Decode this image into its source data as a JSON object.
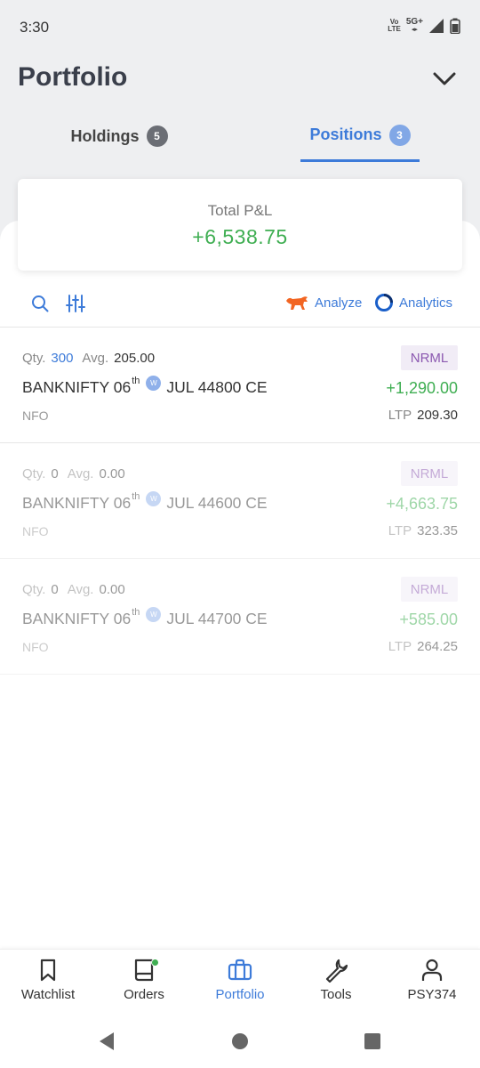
{
  "status_bar": {
    "time": "3:30",
    "volte_line1": "Vo",
    "volte_line2": "LTE",
    "network_label": "5G+"
  },
  "header": {
    "title": "Portfolio",
    "collapse_icon": "chevron-down-icon"
  },
  "tabs": [
    {
      "label": "Holdings",
      "count": "5",
      "active": false
    },
    {
      "label": "Positions",
      "count": "3",
      "active": true
    }
  ],
  "summary": {
    "label": "Total P&L",
    "value": "+6,538.75"
  },
  "toolbar": {
    "search_icon": "search-icon",
    "filter_icon": "sliders-icon",
    "analyze_label": "Analyze",
    "analytics_label": "Analytics"
  },
  "positions": [
    {
      "qty_label": "Qty.",
      "qty": "300",
      "avg_label": "Avg.",
      "avg": "205.00",
      "product": "NRML",
      "symbol": "BANKNIFTY 06",
      "suffix": "th",
      "weekly": "W",
      "contract": "JUL 44800 CE",
      "pnl": "+1,290.00",
      "exchange": "NFO",
      "ltp_label": "LTP",
      "ltp": "209.30",
      "closed": false
    },
    {
      "qty_label": "Qty.",
      "qty": "0",
      "avg_label": "Avg.",
      "avg": "0.00",
      "product": "NRML",
      "symbol": "BANKNIFTY 06",
      "suffix": "th",
      "weekly": "W",
      "contract": "JUL 44600 CE",
      "pnl": "+4,663.75",
      "exchange": "NFO",
      "ltp_label": "LTP",
      "ltp": "323.35",
      "closed": true
    },
    {
      "qty_label": "Qty.",
      "qty": "0",
      "avg_label": "Avg.",
      "avg": "0.00",
      "product": "NRML",
      "symbol": "BANKNIFTY 06",
      "suffix": "th",
      "weekly": "W",
      "contract": "JUL 44700 CE",
      "pnl": "+585.00",
      "exchange": "NFO",
      "ltp_label": "LTP",
      "ltp": "264.25",
      "closed": true
    }
  ],
  "bottom_nav": [
    {
      "label": "Watchlist",
      "icon": "bookmark-icon",
      "active": false
    },
    {
      "label": "Orders",
      "icon": "book-icon",
      "active": false
    },
    {
      "label": "Portfolio",
      "icon": "briefcase-icon",
      "active": true
    },
    {
      "label": "Tools",
      "icon": "wrench-icon",
      "active": false
    },
    {
      "label": "PSY374",
      "icon": "user-icon",
      "active": false
    }
  ],
  "colors": {
    "accent": "#3d7bd9",
    "profit": "#3fae52",
    "product_tag_bg": "#f1ecf6",
    "product_tag_text": "#8b58b0",
    "analyze_bull": "#f26522"
  }
}
